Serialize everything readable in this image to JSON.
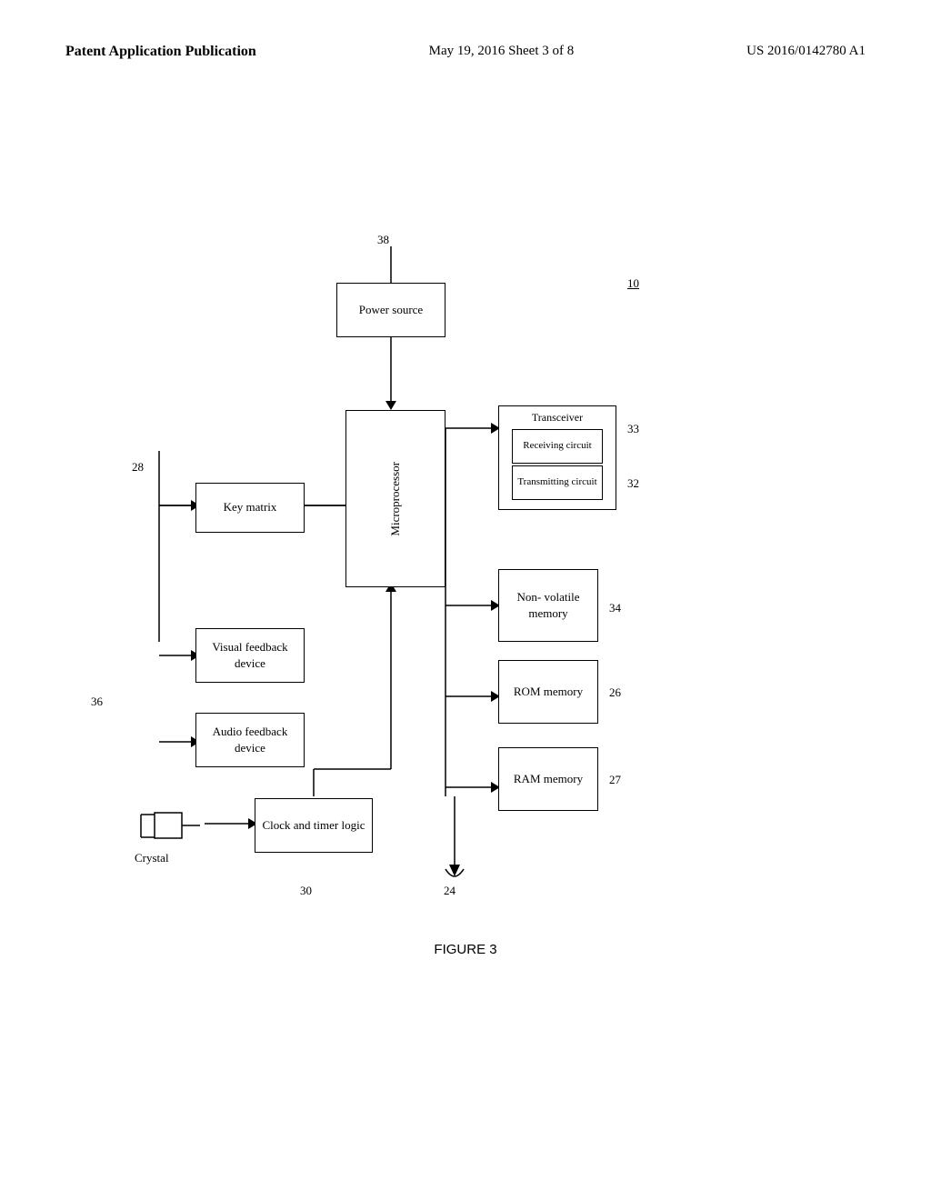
{
  "header": {
    "left": "Patent Application Publication",
    "center": "May 19, 2016  Sheet 3 of 8",
    "right": "US 2016/0142780 A1"
  },
  "figure_caption": "FIGURE 3",
  "diagram": {
    "ref_10": "10",
    "ref_38": "38",
    "ref_28": "28",
    "ref_33": "33",
    "ref_32": "32",
    "ref_34": "34",
    "ref_26": "26",
    "ref_27": "27",
    "ref_36": "36",
    "ref_30": "30",
    "ref_24": "24",
    "boxes": {
      "power_source": "Power source",
      "key_matrix": "Key matrix",
      "microprocessor": "Microprocessor",
      "visual_feedback": "Visual feedback\ndevice",
      "audio_feedback": "Audio feedback\ndevice",
      "transceiver": "Transceiver",
      "receiving_circuit": "Receiving\ncircuit",
      "transmitting_circuit": "Transmitting\ncircuit",
      "nonvolatile_memory": "Non-\nvolatile\nmemory",
      "rom_memory": "ROM\nmemory",
      "ram_memory": "RAM\nmemory",
      "clock_timer": "Clock and\ntimer logic",
      "crystal": "Crystal"
    }
  }
}
